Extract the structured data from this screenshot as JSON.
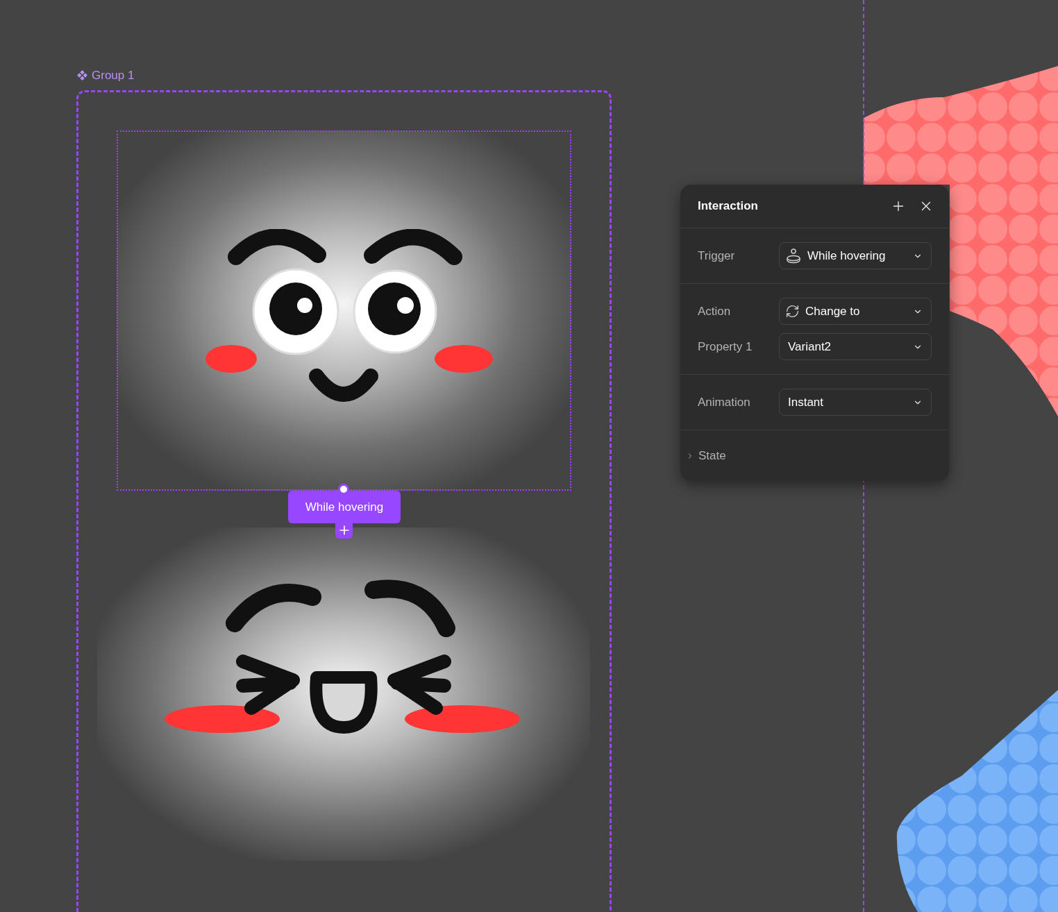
{
  "canvas": {
    "group": {
      "label": "Group 1"
    },
    "hover_tag": {
      "label": "While hovering"
    }
  },
  "panel": {
    "title": "Interaction",
    "sections": [
      {
        "rows": [
          {
            "label": "Trigger",
            "value": "While hovering",
            "kind": "hover"
          }
        ]
      },
      {
        "rows": [
          {
            "label": "Action",
            "value": "Change to",
            "kind": "change"
          },
          {
            "label": "Property 1",
            "value": "Variant2",
            "kind": "plain"
          }
        ]
      },
      {
        "rows": [
          {
            "label": "Animation",
            "value": "Instant",
            "kind": "plain"
          }
        ]
      }
    ],
    "state": {
      "label": "State",
      "expanded": false
    }
  }
}
